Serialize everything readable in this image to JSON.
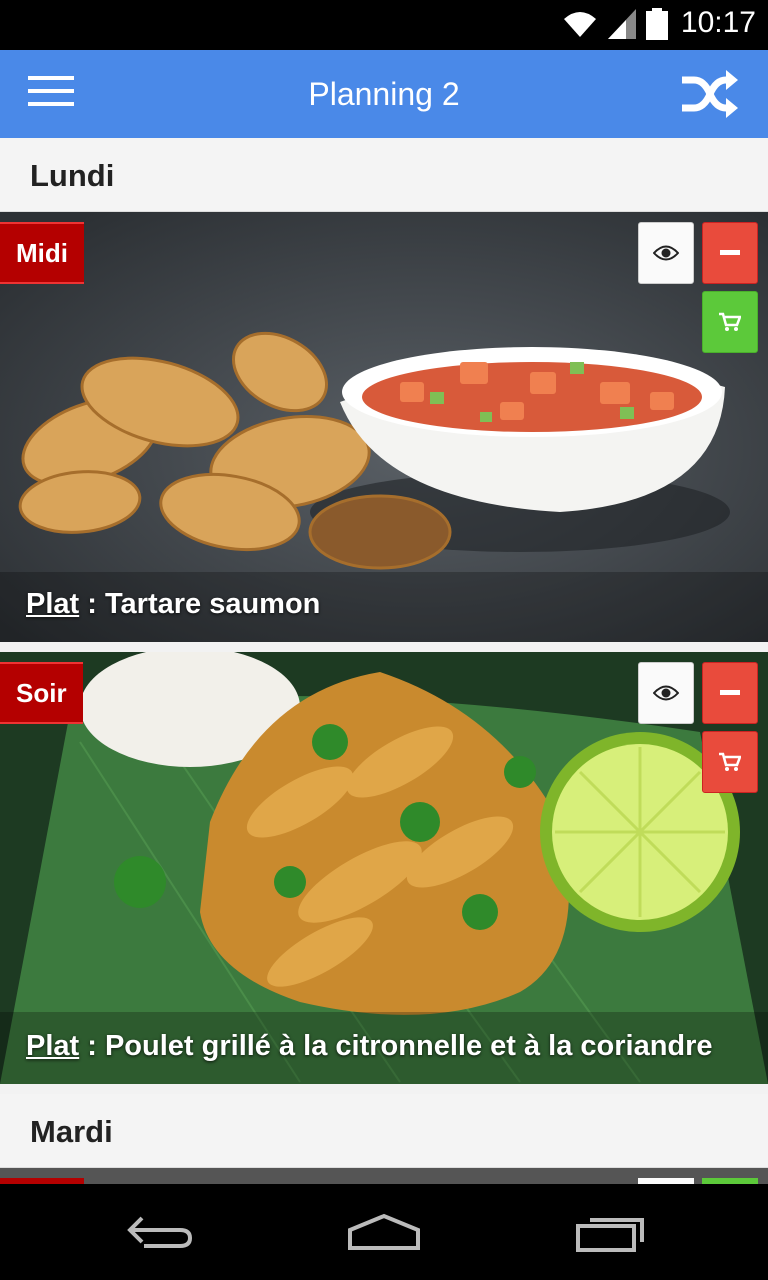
{
  "status_bar": {
    "time": "10:17",
    "icons": [
      "wifi-icon",
      "signal-icon",
      "battery-icon"
    ]
  },
  "app_bar": {
    "title": "Planning 2",
    "menu_icon": "menu-icon",
    "shuffle_icon": "shuffle-icon"
  },
  "days": [
    {
      "label": "Lundi",
      "meals": [
        {
          "tag": "Midi",
          "kind": "Plat",
          "separator": " : ",
          "dish": "Tartare saumon",
          "cart_color": "#5cc93a"
        },
        {
          "tag": "Soir",
          "kind": "Plat",
          "separator": " : ",
          "dish": "Poulet grillé à la citronnelle et à la coriandre",
          "cart_color": "#e94b3c"
        }
      ]
    },
    {
      "label": "Mardi",
      "meals": []
    }
  ],
  "colors": {
    "app_bar": "#4a89e8",
    "tag": "#b40000",
    "remove": "#e94b3c",
    "cart_green": "#5cc93a"
  },
  "nav_bar": {
    "icons": [
      "back-icon",
      "home-icon",
      "recents-icon"
    ]
  }
}
